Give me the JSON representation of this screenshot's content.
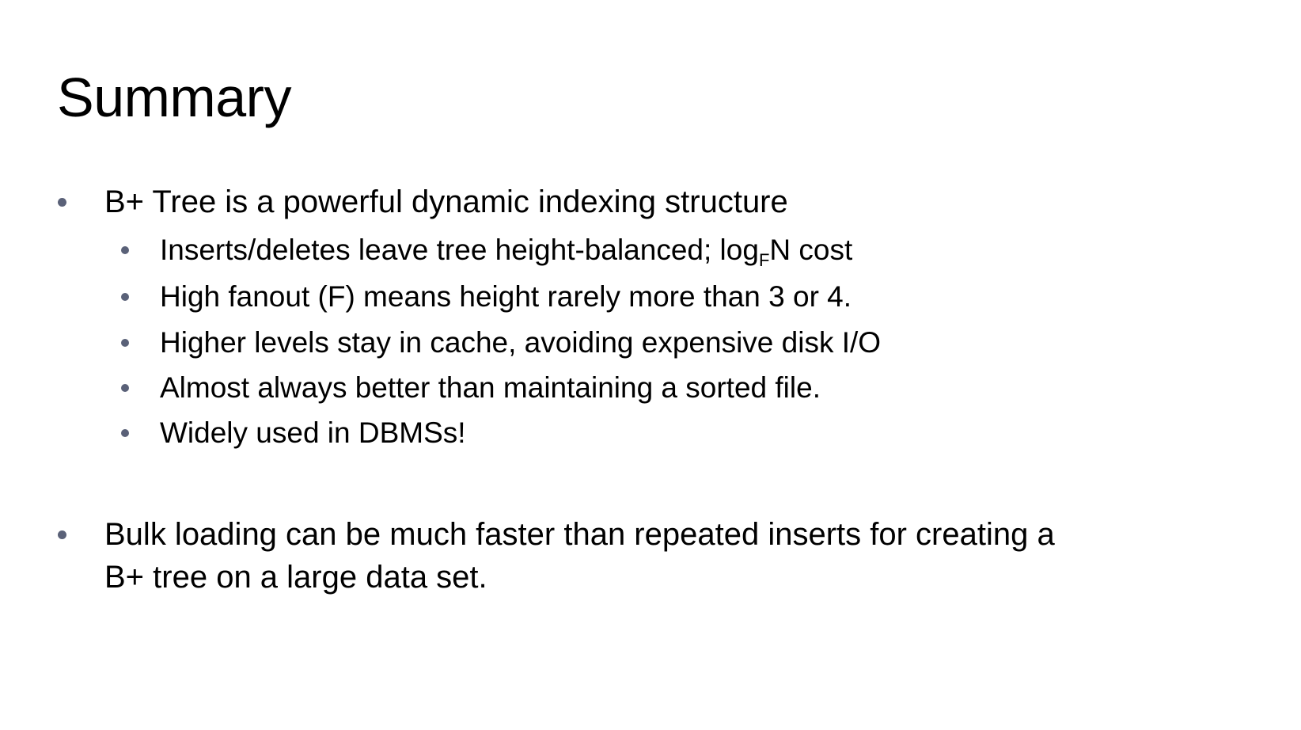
{
  "slide": {
    "title": "Summary",
    "bullets": [
      {
        "text": "B+ Tree is a powerful dynamic indexing structure",
        "sub": [
          {
            "pre": "Inserts/deletes leave tree height-balanced; log",
            "subscript": "F",
            "post": "N cost"
          },
          {
            "text": "High fanout (F) means height rarely more than 3 or 4."
          },
          {
            "text": "Higher levels stay in cache, avoiding expensive disk I/O"
          },
          {
            "text": "Almost always better than maintaining a sorted file."
          },
          {
            "text": "Widely used in DBMSs!"
          }
        ]
      },
      {
        "line1": "Bulk loading can be much faster than repeated inserts for creating a",
        "line2": "B+ tree on a large data set."
      }
    ],
    "bullet_color": "#5a6178"
  }
}
